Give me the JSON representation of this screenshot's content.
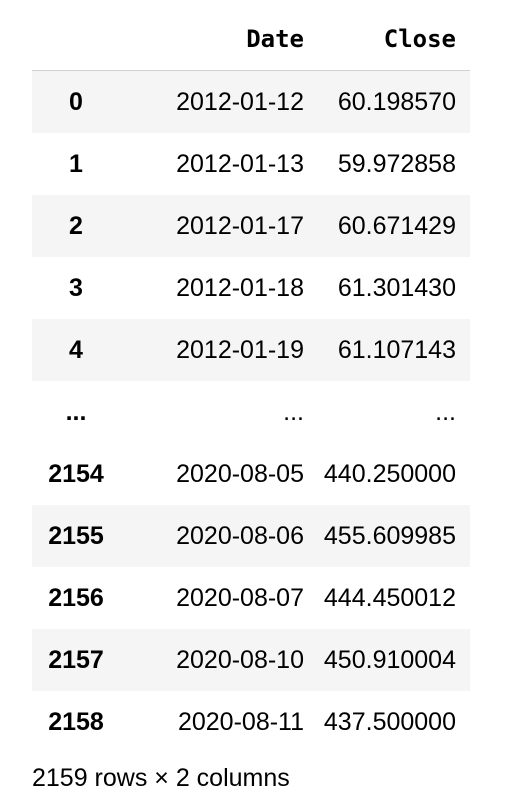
{
  "table": {
    "columns": [
      "",
      "Date",
      "Close"
    ],
    "rows": [
      {
        "index": "0",
        "date": "2012-01-12",
        "close": "60.198570"
      },
      {
        "index": "1",
        "date": "2012-01-13",
        "close": "59.972858"
      },
      {
        "index": "2",
        "date": "2012-01-17",
        "close": "60.671429"
      },
      {
        "index": "3",
        "date": "2012-01-18",
        "close": "61.301430"
      },
      {
        "index": "4",
        "date": "2012-01-19",
        "close": "61.107143"
      },
      {
        "index": "...",
        "date": "...",
        "close": "..."
      },
      {
        "index": "2154",
        "date": "2020-08-05",
        "close": "440.250000"
      },
      {
        "index": "2155",
        "date": "2020-08-06",
        "close": "455.609985"
      },
      {
        "index": "2156",
        "date": "2020-08-07",
        "close": "444.450012"
      },
      {
        "index": "2157",
        "date": "2020-08-10",
        "close": "450.910004"
      },
      {
        "index": "2158",
        "date": "2020-08-11",
        "close": "437.500000"
      }
    ]
  },
  "footer": {
    "shape": "2159 rows × 2 columns"
  },
  "colors": {
    "stripe": "#f5f5f5",
    "header_border": "#d0d0d0"
  }
}
